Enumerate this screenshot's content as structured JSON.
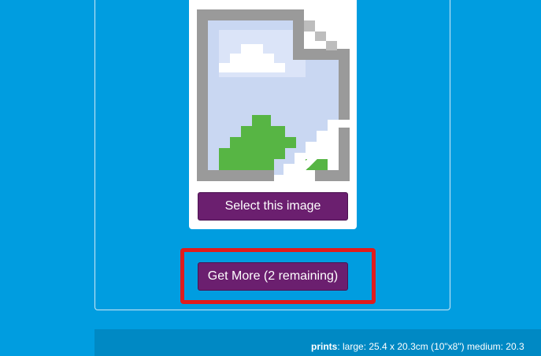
{
  "gallery": {
    "select_label": "Select this image",
    "get_more_label": "Get More (2 remaining)",
    "image_icon": "broken-image-icon"
  },
  "footer": {
    "prints_label": "prints",
    "prints_text": ": large: 25.4 x 20.3cm (10\"x8\") medium: 20.3"
  },
  "colors": {
    "background": "#009de0",
    "button": "#6b1f6f",
    "highlight": "#e11c1c",
    "footer_bar": "#0089c4"
  }
}
